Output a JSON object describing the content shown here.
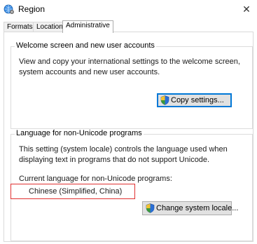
{
  "window": {
    "title": "Region",
    "close_glyph": "✕"
  },
  "tabs": [
    {
      "label": "Formats",
      "active": false
    },
    {
      "label": "Location",
      "active": false
    },
    {
      "label": "Administrative",
      "active": true
    }
  ],
  "welcome_group": {
    "title": "Welcome screen and new user accounts",
    "description": "View and copy your international settings to the welcome screen, system accounts and new user accounts.",
    "button_label": "Copy settings..."
  },
  "unicode_group": {
    "title": "Language for non-Unicode programs",
    "description": "This setting (system locale) controls the language used when displaying text in programs that do not support Unicode.",
    "current_label": "Current language for non-Unicode programs:",
    "current_value": "Chinese (Simplified, China)",
    "button_label": "Change system locale..."
  },
  "icons": {
    "app": "globe-settings-icon",
    "button": "uac-shield-icon"
  },
  "colors": {
    "highlight_border": "#e03030",
    "focus_border": "#0078d7"
  }
}
